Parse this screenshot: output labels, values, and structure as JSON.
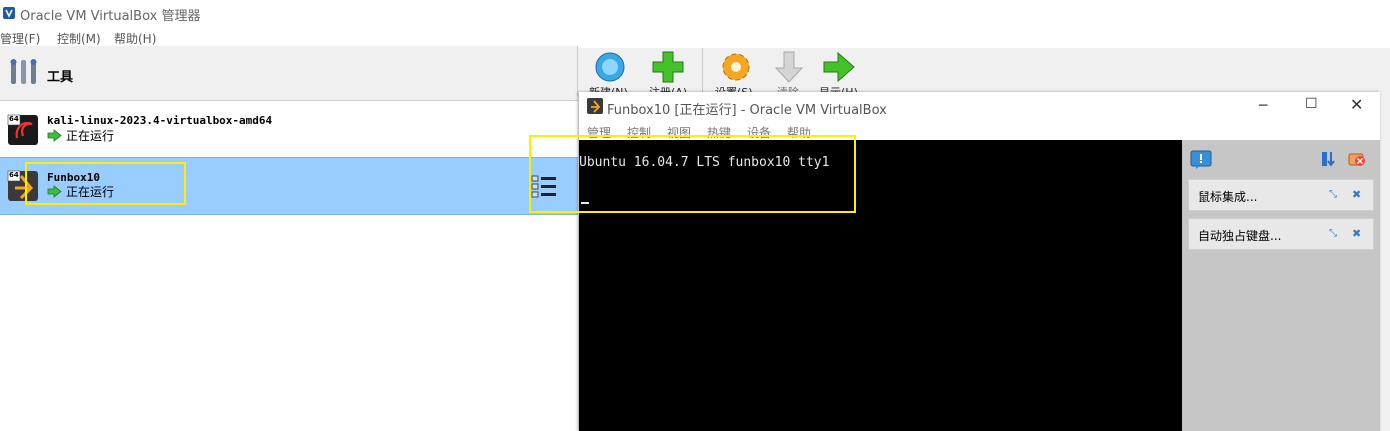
{
  "manager": {
    "title": "Oracle VM VirtualBox 管理器",
    "menu": [
      "管理(F)",
      "控制(M)",
      "帮助(H)"
    ],
    "tools_label": "工具",
    "toolbar": [
      {
        "label": "新建(N)",
        "icon": "new-icon"
      },
      {
        "label": "注册(A)",
        "icon": "add-icon"
      },
      {
        "label": "设置(S)",
        "icon": "settings-icon"
      },
      {
        "label": "清除",
        "icon": "discard-icon"
      },
      {
        "label": "显示(H)",
        "icon": "show-icon"
      }
    ],
    "vms": [
      {
        "name": "kali-linux-2023.4-virtualbox-amd64",
        "state": "正在运行",
        "badge": "64"
      },
      {
        "name": "Funbox10",
        "state": "正在运行",
        "badge": "64"
      }
    ]
  },
  "vm_window": {
    "title": "Funbox10 [正在运行] - Oracle VM VirtualBox",
    "menu": [
      "管理",
      "控制",
      "视图",
      "热键",
      "设备",
      "帮助"
    ],
    "console_line": "Ubuntu 16.04.7 LTS funbox10 tty1",
    "notices": [
      "鼠标集成...",
      "自动独占键盘..."
    ]
  },
  "colors": {
    "selected_row": "#99ccff",
    "highlight": "#ffee00",
    "console_bg": "#000000"
  }
}
